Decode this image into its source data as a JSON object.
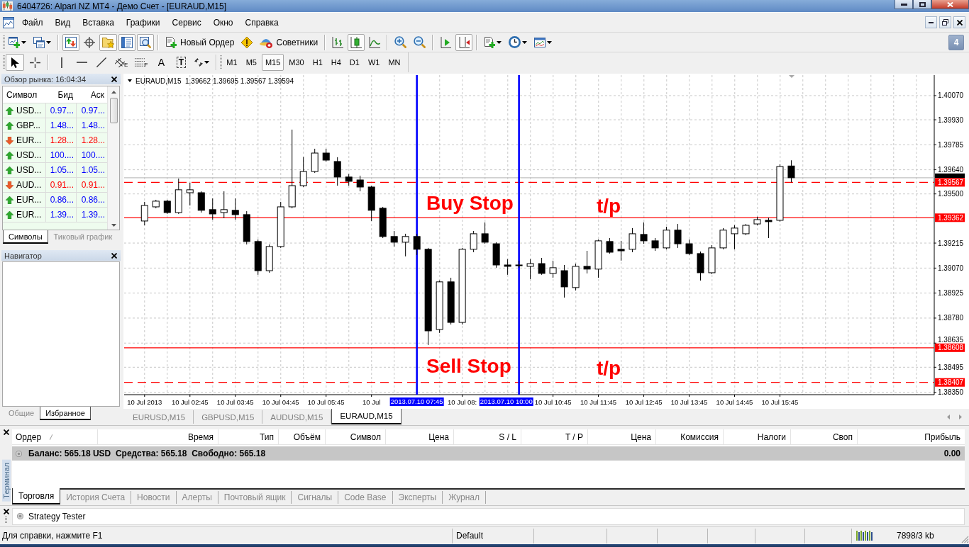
{
  "window": {
    "title": "6404726: Alpari NZ MT4 - Демо Счет - [EURAUD,M15]"
  },
  "menu": {
    "items": [
      "Файл",
      "Вид",
      "Вставка",
      "Графики",
      "Сервис",
      "Окно",
      "Справка"
    ]
  },
  "toolbar": {
    "buttons": [
      {
        "pressed": false
      },
      {
        "pressed": false
      },
      {
        "pressed": true
      },
      {
        "pressed": false
      },
      {
        "pressed": true
      },
      {
        "pressed": true
      },
      {
        "pressed": true
      },
      {
        "label": "Новый Ордер",
        "pressed": false
      },
      {
        "pressed": false
      },
      {
        "label": "Советники",
        "pressed": false
      },
      {
        "pressed": false
      },
      {
        "pressed": true
      },
      {
        "pressed": false
      },
      {
        "pressed": false
      },
      {
        "pressed": false
      },
      {
        "pressed": false
      },
      {
        "pressed": true
      },
      {
        "pressed": false
      },
      {
        "pressed": false
      },
      {
        "pressed": false
      }
    ]
  },
  "notifications": {
    "count": "4"
  },
  "drawing_toolbar": {
    "tools": [
      {
        "pressed": true
      },
      {
        "pressed": false
      },
      {
        "pressed": false
      },
      {
        "pressed": false
      },
      {
        "pressed": false
      },
      {
        "label": "E",
        "pressed": false
      },
      {
        "label": "F",
        "pressed": false
      },
      {
        "label": "A",
        "pressed": false
      },
      {
        "label": "T",
        "pressed": false
      },
      {
        "pressed": false
      }
    ]
  },
  "periods": [
    {
      "label": "M1",
      "selected": false
    },
    {
      "label": "M5",
      "selected": false
    },
    {
      "label": "M15",
      "selected": true
    },
    {
      "label": "M30",
      "selected": false
    },
    {
      "label": "H1",
      "selected": false
    },
    {
      "label": "H4",
      "selected": false
    },
    {
      "label": "D1",
      "selected": false
    },
    {
      "label": "W1",
      "selected": false
    },
    {
      "label": "MN",
      "selected": false
    }
  ],
  "market_watch": {
    "title": "Обзор рынка: 16:04:34",
    "columns": [
      "Символ",
      "Бид",
      "Аск"
    ],
    "rows": [
      {
        "symbol": "USD...",
        "bid": "0.97...",
        "ask": "0.97...",
        "rising": true
      },
      {
        "symbol": "GBP...",
        "bid": "1.48...",
        "ask": "1.48...",
        "rising": true
      },
      {
        "symbol": "EUR...",
        "bid": "1.28...",
        "ask": "1.28...",
        "rising": false
      },
      {
        "symbol": "USD...",
        "bid": "100....",
        "ask": "100....",
        "rising": true
      },
      {
        "symbol": "USD...",
        "bid": "1.05...",
        "ask": "1.05...",
        "rising": true
      },
      {
        "symbol": "AUD...",
        "bid": "0.91...",
        "ask": "0.91...",
        "rising": false
      },
      {
        "symbol": "EUR...",
        "bid": "0.86...",
        "ask": "0.86...",
        "rising": true
      },
      {
        "symbol": "EUR...",
        "bid": "1.39...",
        "ask": "1.39...",
        "rising": true
      }
    ],
    "tabs": [
      {
        "label": "Символы",
        "selected": true
      },
      {
        "label": "Тиковый график",
        "selected": false
      }
    ]
  },
  "navigator": {
    "title": "Навигатор",
    "tabs": [
      {
        "label": "Общие",
        "selected": false
      },
      {
        "label": "Избранное",
        "selected": true
      }
    ]
  },
  "chart": {
    "chart_data": [
      {
        "type": "candlestick",
        "title": "EURAUD,M15  1.39662 1.39695 1.39567 1.39594",
        "x": [
          "2013-07-10T01:45",
          "2013-07-10T02:00",
          "2013-07-10T02:15",
          "2013-07-10T02:30",
          "2013-07-10T02:45",
          "2013-07-10T03:00",
          "2013-07-10T03:15",
          "2013-07-10T03:30",
          "2013-07-10T03:45",
          "2013-07-10T04:00",
          "2013-07-10T04:15",
          "2013-07-10T04:30",
          "2013-07-10T04:45",
          "2013-07-10T05:00",
          "2013-07-10T05:15",
          "2013-07-10T05:30",
          "2013-07-10T05:45",
          "2013-07-10T06:00",
          "2013-07-10T06:15",
          "2013-07-10T06:30",
          "2013-07-10T06:45",
          "2013-07-10T07:00",
          "2013-07-10T07:15",
          "2013-07-10T07:30",
          "2013-07-10T07:45",
          "2013-07-10T08:00",
          "2013-07-10T08:15",
          "2013-07-10T08:30",
          "2013-07-10T08:45",
          "2013-07-10T09:00",
          "2013-07-10T09:15",
          "2013-07-10T09:30",
          "2013-07-10T09:45",
          "2013-07-10T10:00",
          "2013-07-10T10:15",
          "2013-07-10T10:30",
          "2013-07-10T10:45",
          "2013-07-10T11:00",
          "2013-07-10T11:15",
          "2013-07-10T11:30",
          "2013-07-10T11:45",
          "2013-07-10T12:00",
          "2013-07-10T12:15",
          "2013-07-10T12:30",
          "2013-07-10T12:45",
          "2013-07-10T13:00",
          "2013-07-10T13:15",
          "2013-07-10T13:30",
          "2013-07-10T13:45",
          "2013-07-10T14:00",
          "2013-07-10T14:15",
          "2013-07-10T14:30",
          "2013-07-10T14:45",
          "2013-07-10T15:00",
          "2013-07-10T15:15",
          "2013-07-10T15:30",
          "2013-07-10T15:45",
          "2013-07-10T16:00"
        ],
        "ohlc": [
          [
            1.39343,
            1.39454,
            1.39318,
            1.39433
          ],
          [
            1.39425,
            1.39466,
            1.39417,
            1.39458
          ],
          [
            1.39458,
            1.39466,
            1.39384,
            1.39392
          ],
          [
            1.39392,
            1.39589,
            1.39384,
            1.39524
          ],
          [
            1.39507,
            1.39565,
            1.39433,
            1.39524
          ],
          [
            1.39507,
            1.39515,
            1.39392,
            1.39405
          ],
          [
            1.39409,
            1.39474,
            1.39351,
            1.39384
          ],
          [
            1.39392,
            1.39515,
            1.39359,
            1.39409
          ],
          [
            1.39405,
            1.39474,
            1.39351,
            1.3938
          ],
          [
            1.3938,
            1.394,
            1.39207,
            1.39224
          ],
          [
            1.39224,
            1.39236,
            1.39031,
            1.39055
          ],
          [
            1.39055,
            1.39207,
            1.39043,
            1.39195
          ],
          [
            1.39195,
            1.39454,
            1.39187,
            1.39425
          ],
          [
            1.39425,
            1.39873,
            1.39417,
            1.39548
          ],
          [
            1.39548,
            1.39713,
            1.3954,
            1.3963
          ],
          [
            1.3963,
            1.39762,
            1.39622,
            1.39737
          ],
          [
            1.39737,
            1.39762,
            1.39688,
            1.39696
          ],
          [
            1.39688,
            1.39713,
            1.39548,
            1.39598
          ],
          [
            1.39598,
            1.39614,
            1.39548,
            1.39573
          ],
          [
            1.39581,
            1.39606,
            1.39515,
            1.3954
          ],
          [
            1.3954,
            1.39548,
            1.39343,
            1.39405
          ],
          [
            1.39417,
            1.39425,
            1.39244,
            1.39253
          ],
          [
            1.39253,
            1.39285,
            1.39195,
            1.3922
          ],
          [
            1.3922,
            1.39269,
            1.39138,
            1.39253
          ],
          [
            1.39253,
            1.39269,
            1.39146,
            1.39179
          ],
          [
            1.39179,
            1.39187,
            1.38624,
            1.38706
          ],
          [
            1.38714,
            1.38998,
            1.38694,
            1.3899
          ],
          [
            1.3899,
            1.39014,
            1.38743,
            1.38755
          ],
          [
            1.38755,
            1.39187,
            1.38743,
            1.39179
          ],
          [
            1.39179,
            1.39285,
            1.39162,
            1.39269
          ],
          [
            1.39269,
            1.39335,
            1.39211,
            1.3922
          ],
          [
            1.39211,
            1.3922,
            1.39072,
            1.39088
          ],
          [
            1.39088,
            1.39121,
            1.39031,
            1.3908
          ],
          [
            1.39084,
            1.39113,
            1.39072,
            1.39088
          ],
          [
            1.3908,
            1.39121,
            1.39006,
            1.39096
          ],
          [
            1.39096,
            1.39129,
            1.39031,
            1.39039
          ],
          [
            1.39039,
            1.39113,
            1.39014,
            1.39072
          ],
          [
            1.39055,
            1.39088,
            1.38899,
            1.38961
          ],
          [
            1.38957,
            1.39096,
            1.3894,
            1.3908
          ],
          [
            1.3908,
            1.3917,
            1.39039,
            1.39064
          ],
          [
            1.39064,
            1.39236,
            1.39014,
            1.39228
          ],
          [
            1.39224,
            1.39244,
            1.39154,
            1.39162
          ],
          [
            1.39179,
            1.39228,
            1.39113,
            1.3917
          ],
          [
            1.39179,
            1.39302,
            1.39162,
            1.39269
          ],
          [
            1.39265,
            1.39335,
            1.39211,
            1.39228
          ],
          [
            1.39228,
            1.39244,
            1.3917,
            1.39187
          ],
          [
            1.39187,
            1.3931,
            1.39179,
            1.3929
          ],
          [
            1.3929,
            1.39326,
            1.39187,
            1.39211
          ],
          [
            1.39211,
            1.39236,
            1.39146,
            1.39154
          ],
          [
            1.39154,
            1.39166,
            1.38998,
            1.39043
          ],
          [
            1.39043,
            1.39203,
            1.39035,
            1.39187
          ],
          [
            1.39187,
            1.39302,
            1.39179,
            1.3929
          ],
          [
            1.39269,
            1.39318,
            1.39179,
            1.39302
          ],
          [
            1.39269,
            1.39326,
            1.39261,
            1.39318
          ],
          [
            1.39326,
            1.39368,
            1.39318,
            1.39351
          ],
          [
            1.39347,
            1.39363,
            1.39244,
            1.39339
          ],
          [
            1.39347,
            1.39672,
            1.39339,
            1.39659
          ],
          [
            1.39662,
            1.39695,
            1.39567,
            1.39594
          ]
        ],
        "xlim": [
          "2013-07-10T01:18",
          "2013-07-10T19:09"
        ],
        "xticks": [
          {
            "value": "2013-07-10T01:45",
            "label": "10 Jul 2013"
          },
          {
            "value": "2013-07-10T02:45",
            "label": "10 Jul 02:45"
          },
          {
            "value": "2013-07-10T03:45",
            "label": "10 Jul 03:45"
          },
          {
            "value": "2013-07-10T04:45",
            "label": "10 Jul 04:45"
          },
          {
            "value": "2013-07-10T05:45",
            "label": "10 Jul 05:45"
          },
          {
            "value": "2013-07-10T06:45",
            "label": "10 Jul"
          },
          {
            "value": "2013-07-10T08:45",
            "label": "10 Jul 08:"
          },
          {
            "value": "2013-07-10T10:45",
            "label": "10 Jul 10:45"
          },
          {
            "value": "2013-07-10T11:45",
            "label": "10 Jul 11:45"
          },
          {
            "value": "2013-07-10T12:45",
            "label": "10 Jul 12:45"
          },
          {
            "value": "2013-07-10T13:45",
            "label": "10 Jul 13:45"
          },
          {
            "value": "2013-07-10T14:45",
            "label": "10 Jul 14:45"
          },
          {
            "value": "2013-07-10T15:45",
            "label": "10 Jul 15:45"
          }
        ],
        "yticks": [
          {
            "value": 1.4007,
            "label": "1.40070"
          },
          {
            "value": 1.3993,
            "label": "1.39930"
          },
          {
            "value": 1.39785,
            "label": "1.39785"
          },
          {
            "value": 1.3964,
            "label": "1.39640"
          },
          {
            "value": 1.395,
            "label": "1.39500"
          },
          {
            "value": 1.39215,
            "label": "1.39215"
          },
          {
            "value": 1.3907,
            "label": "1.39070"
          },
          {
            "value": 1.38925,
            "label": "1.38925"
          },
          {
            "value": 1.3878,
            "label": "1.38780"
          },
          {
            "value": 1.38635,
            "label": "1.38635"
          },
          {
            "value": 1.38495,
            "label": "1.38495"
          },
          {
            "value": 1.3835,
            "label": "1.38350"
          }
        ],
        "ylim": [
          1.38336,
          1.40189
        ],
        "grid": true,
        "ref_lines": [
          {
            "axis": "y",
            "value": 1.39594,
            "color": "#c0c0c0",
            "line_style": "solid"
          },
          {
            "axis": "y",
            "value": 1.39567,
            "label": "1.39567",
            "color": "#ff0000",
            "line_style": "dashed"
          },
          {
            "axis": "y",
            "value": 1.39362,
            "label": "1.39362",
            "color": "#ff0000",
            "line_style": "solid"
          },
          {
            "axis": "y",
            "value": 1.38608,
            "label": "1.38608",
            "color": "#ff0000",
            "line_style": "solid"
          },
          {
            "axis": "y",
            "value": 1.38407,
            "label": "1.38407",
            "color": "#ff0000",
            "line_style": "dashed"
          },
          {
            "axis": "x",
            "value": "2013-07-10T07:45",
            "label": "2013.07.10 07:45",
            "color": "#0000ff",
            "line_style": "solid"
          },
          {
            "axis": "x",
            "value": "2013-07-10T10:00",
            "label": "2013.07.10 10:00",
            "color": "#0000ff",
            "line_style": "solid"
          }
        ],
        "annotations": [
          "Buy Stop",
          "t/p",
          "Sell Stop",
          "t/p"
        ]
      }
    ],
    "tabs": [
      {
        "label": "EURUSD,M15",
        "selected": false
      },
      {
        "label": "GBPUSD,M15",
        "selected": false
      },
      {
        "label": "AUDUSD,M15",
        "selected": false
      },
      {
        "label": "EURAUD,M15",
        "selected": true
      }
    ]
  },
  "terminal": {
    "label": "Терминал",
    "columns": [
      "Ордер",
      "Время",
      "Тип",
      "Объём",
      "Символ",
      "Цена",
      "S / L",
      "T / P",
      "Цена",
      "Комиссия",
      "Налоги",
      "Своп",
      "Прибыль"
    ],
    "balance": {
      "summary": "Баланс: 565.18 USD  Средства: 565.18  Свободно: 565.18",
      "profit": "0.00"
    },
    "tabs": [
      {
        "label": "Торговля",
        "selected": true
      },
      {
        "label": "История Счета",
        "selected": false
      },
      {
        "label": "Новости",
        "selected": false
      },
      {
        "label": "Алерты",
        "selected": false
      },
      {
        "label": "Почтовый ящик",
        "selected": false
      },
      {
        "label": "Сигналы",
        "selected": false
      },
      {
        "label": "Code Base",
        "selected": false
      },
      {
        "label": "Эксперты",
        "selected": false
      },
      {
        "label": "Журнал",
        "selected": false
      }
    ]
  },
  "strategy_tester": {
    "title": "Strategy Tester"
  },
  "status_bar": {
    "help": "Для справки, нажмите F1",
    "profile": "Default",
    "traffic": "7898/3 kb"
  }
}
